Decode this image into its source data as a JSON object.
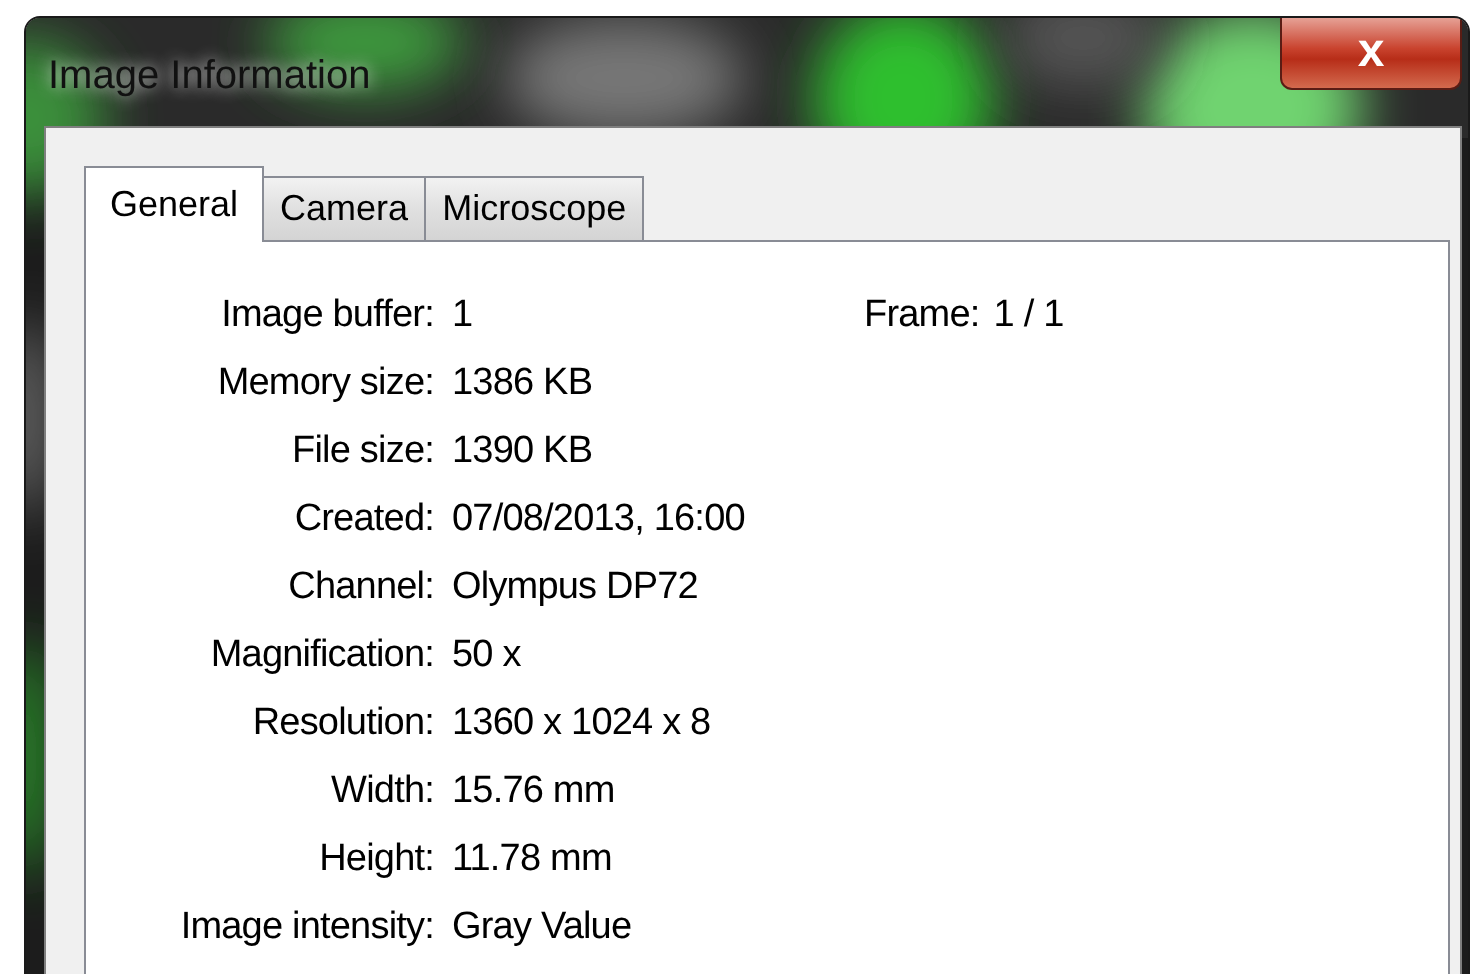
{
  "window": {
    "title": "Image Information",
    "close": "x"
  },
  "tabs": [
    {
      "label": "General",
      "selected": true
    },
    {
      "label": "Camera",
      "selected": false
    },
    {
      "label": "Microscope",
      "selected": false
    }
  ],
  "frame": {
    "label": "Frame:",
    "value": "1 / 1"
  },
  "fields": [
    {
      "label": "Image buffer:",
      "value": "1"
    },
    {
      "label": "Memory size:",
      "value": "1386 KB"
    },
    {
      "label": "File size:",
      "value": "1390 KB"
    },
    {
      "label": "Created:",
      "value": "07/08/2013, 16:00"
    },
    {
      "label": "Channel:",
      "value": "Olympus DP72"
    },
    {
      "label": "Magnification:",
      "value": "50 x"
    },
    {
      "label": "Resolution:",
      "value": "1360 x 1024 x 8"
    },
    {
      "label": "Width:",
      "value": "15.76 mm"
    },
    {
      "label": "Height:",
      "value": "11.78 mm"
    },
    {
      "label": "Image intensity:",
      "value": "Gray Value"
    }
  ]
}
